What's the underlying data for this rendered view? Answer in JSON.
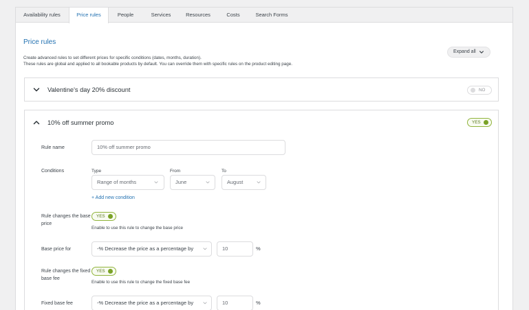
{
  "tabs": [
    {
      "label": "Availability rules",
      "active": false
    },
    {
      "label": "Price rules",
      "active": true
    },
    {
      "label": "People",
      "active": false
    },
    {
      "label": "Services",
      "active": false
    },
    {
      "label": "Resources",
      "active": false
    },
    {
      "label": "Costs",
      "active": false
    },
    {
      "label": "Search Forms",
      "active": false
    }
  ],
  "page": {
    "title": "Price rules",
    "description_line1": "Create advanced rules to set different prices for specific conditions (dates, months, duration).",
    "description_line2": "These rules are global and applied to all bookable products by default. You can override them with specific rules on the product editing page.",
    "expand_all_label": "Expand all"
  },
  "rules": [
    {
      "title": "Valentine's day 20% discount",
      "enabled_label": "NO",
      "collapsed": true
    },
    {
      "title": "10% off summer promo",
      "enabled_label": "YES",
      "collapsed": false
    }
  ],
  "form": {
    "rule_name_label": "Rule name",
    "rule_name_value": "10% off summer promo",
    "conditions_label": "Conditions",
    "type_label": "Type",
    "type_value": "Range of months",
    "from_label": "From",
    "from_value": "June",
    "to_label": "To",
    "to_value": "August",
    "add_condition_label": "+ Add new condition",
    "base_price_toggle_label": "Rule changes the base price",
    "base_price_toggle_value": "YES",
    "base_price_hint": "Enable to use this rule to change the base price",
    "base_price_for_label": "Base price for",
    "base_price_for_value": "-% Decrease the price as a percentage by",
    "base_price_amount": "10",
    "base_price_unit": "%",
    "fixed_fee_toggle_label": "Rule changes the fixed base fee",
    "fixed_fee_toggle_value": "YES",
    "fixed_fee_hint": "Enable to use this rule to change the fixed base fee",
    "fixed_fee_label": "Fixed base fee",
    "fixed_fee_value": "-% Decrease the price as a percentage by",
    "fixed_fee_amount": "10",
    "fixed_fee_unit": "%"
  },
  "colors": {
    "accent": "#2271b1",
    "toggle_on": "#7aa227",
    "border": "#dcdcde",
    "background": "#f0f0f1"
  }
}
